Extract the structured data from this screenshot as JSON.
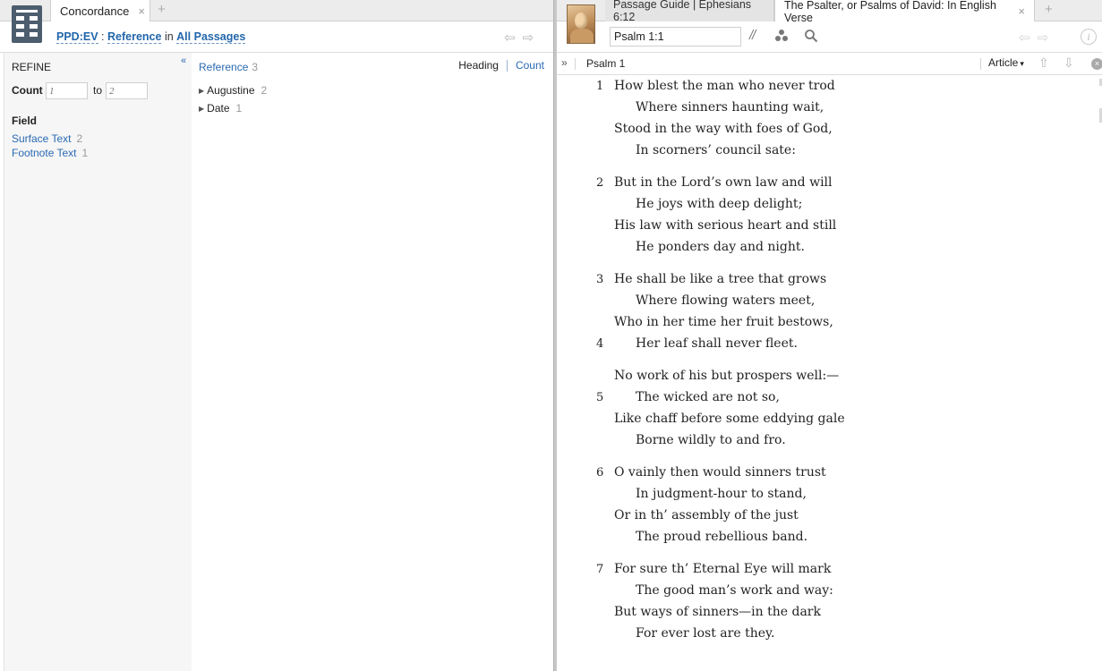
{
  "left": {
    "tab_label": "Concordance",
    "tab_close": "×",
    "tab_add": "+",
    "query": {
      "resource": "PPD:EV",
      "separator": ":",
      "by": "Reference",
      "in_word": "in",
      "scope": "All Passages"
    },
    "nav_back": "⇦",
    "nav_forward": "⇨",
    "refine": {
      "title": "REFINE",
      "collapse": "«",
      "count_label": "Count",
      "count_from_placeholder": "1",
      "count_to_label": "to",
      "count_to_placeholder": "2",
      "field_title": "Field",
      "fields": [
        {
          "label": "Surface Text",
          "count": "2"
        },
        {
          "label": "Footnote Text",
          "count": "1"
        }
      ]
    },
    "results": {
      "header": "Reference",
      "header_count": "3",
      "heading_label": "Heading",
      "count_label": "Count",
      "items": [
        {
          "label": "Augustine",
          "count": "2"
        },
        {
          "label": "Date",
          "count": "1"
        }
      ]
    }
  },
  "right": {
    "tab_inactive": "Passage Guide | Ephesians 6:12",
    "tab_active": "The Psalter, or Psalms of David: In English Verse",
    "tab_close": "×",
    "tab_add": "+",
    "reference_value": "Psalm 1:1",
    "parallel_icon": "//",
    "info_icon": "i",
    "nav_back": "⇦",
    "nav_forward": "⇨",
    "section": {
      "expand": "»",
      "title": "Psalm 1",
      "article_label": "Article",
      "article_caret": "▾",
      "up": "⇧",
      "down": "⇩",
      "close": "×"
    },
    "psalm_lines": [
      {
        "num": "1",
        "text": "How blest the man who never trod"
      },
      {
        "num": "",
        "text": "Where sinners haunting wait,"
      },
      {
        "num": "",
        "text": "Stood in the way with foes of God,"
      },
      {
        "num": "",
        "text": "In scorners’ council sate:"
      },
      {
        "num": "2",
        "text": "But in the Lord’s own law and will"
      },
      {
        "num": "",
        "text": "He joys with deep delight;"
      },
      {
        "num": "",
        "text": "His law with serious heart and still"
      },
      {
        "num": "",
        "text": "He ponders day and night."
      },
      {
        "num": "3",
        "text": "He shall be like a tree that grows"
      },
      {
        "num": "",
        "text": "Where flowing waters meet,"
      },
      {
        "num": "",
        "text": "Who in her time her fruit bestows,"
      },
      {
        "num": "4",
        "text": "Her leaf shall never fleet."
      },
      {
        "num": "",
        "text": "No work of his but prospers well:—"
      },
      {
        "num": "5",
        "text": "The wicked are not so,"
      },
      {
        "num": "",
        "text": "Like chaff before some eddying gale"
      },
      {
        "num": "",
        "text": "Borne wildly to and fro."
      },
      {
        "num": "6",
        "text": "O vainly then would sinners trust"
      },
      {
        "num": "",
        "text": "In judgment-hour to stand,"
      },
      {
        "num": "",
        "text": "Or in th’ assembly of the just"
      },
      {
        "num": "",
        "text": "The proud rebellious band."
      },
      {
        "num": "7",
        "text": "For sure th’ Eternal Eye will mark"
      },
      {
        "num": "",
        "text": "The good man’s work and way:"
      },
      {
        "num": "",
        "text": "But ways of sinners—in the dark"
      },
      {
        "num": "",
        "text": "For ever lost are they."
      }
    ]
  }
}
